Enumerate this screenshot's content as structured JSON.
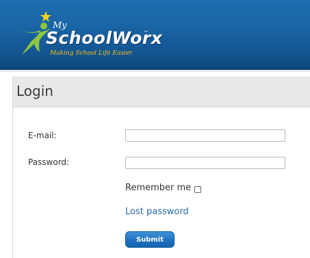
{
  "header": {
    "logo": {
      "prefix": "My",
      "name": "SchoolWorx",
      "trademark": "™",
      "tagline": "Making School Life Easier"
    }
  },
  "login": {
    "title": "Login",
    "email_label": "E-mail:",
    "email_value": "",
    "password_label": "Password:",
    "password_value": "",
    "remember_label": "Remember me",
    "remember_checked": false,
    "lost_password": "Lost password",
    "submit_label": "Submit"
  },
  "colors": {
    "header": "#1a66a6",
    "link": "#2a6aa8",
    "button": "#1f72bf",
    "tagline": "#f2c31a"
  }
}
